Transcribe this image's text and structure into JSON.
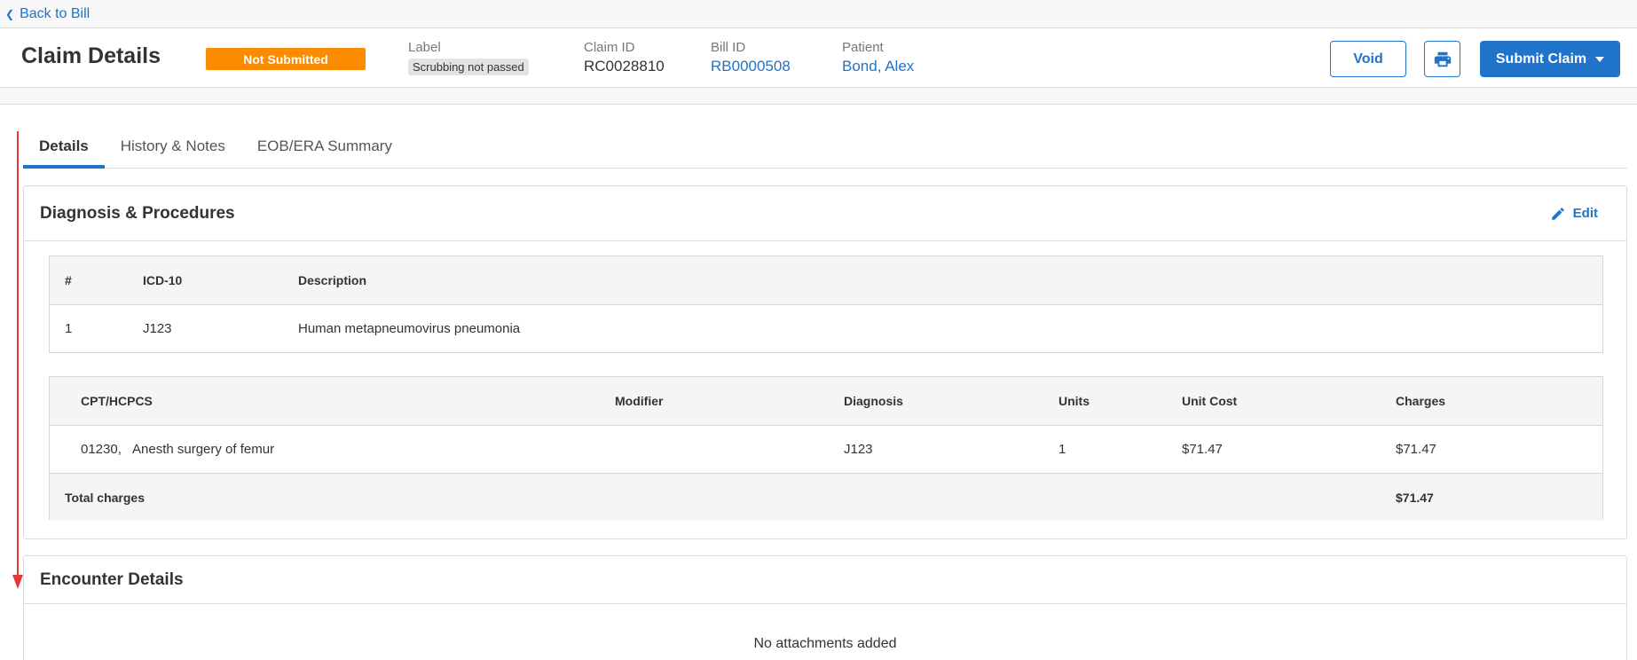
{
  "nav": {
    "back_label": "Back to Bill"
  },
  "header": {
    "title": "Claim Details",
    "status": "Not Submitted",
    "label_caption": "Label",
    "label_value": "Scrubbing not passed",
    "claim_id_caption": "Claim ID",
    "claim_id": "RC0028810",
    "bill_id_caption": "Bill ID",
    "bill_id": "RB0000508",
    "patient_caption": "Patient",
    "patient": "Bond, Alex",
    "void_label": "Void",
    "submit_label": "Submit Claim"
  },
  "tabs": [
    {
      "label": "Details"
    },
    {
      "label": "History & Notes"
    },
    {
      "label": "EOB/ERA Summary"
    }
  ],
  "diagnosis": {
    "title": "Diagnosis & Procedures",
    "edit_label": "Edit",
    "icd_table": {
      "headers": [
        "#",
        "ICD-10",
        "Description"
      ],
      "rows": [
        [
          "1",
          "J123",
          "Human metapneumovirus pneumonia"
        ]
      ]
    },
    "cpt_table": {
      "headers": [
        "CPT/HCPCS",
        "Modifier",
        "Diagnosis",
        "Units",
        "Unit Cost",
        "Charges"
      ],
      "rows": [
        {
          "code": "01230,",
          "desc": "Anesth surgery of femur",
          "modifier": "",
          "diagnosis": "J123",
          "units": "1",
          "unit_cost": "$71.47",
          "charges": "$71.47"
        }
      ],
      "total_label": "Total charges",
      "total_value": "$71.47"
    }
  },
  "encounter": {
    "title": "Encounter Details",
    "empty_text": "No attachments added"
  },
  "colors": {
    "accent": "#1f73c9",
    "status_orange": "#fb8c00",
    "annotation_red": "#e53935"
  }
}
